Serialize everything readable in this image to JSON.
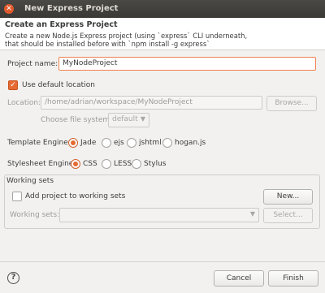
{
  "window": {
    "title": "New Express Project",
    "close_glyph": "✕"
  },
  "header": {
    "title": "Create an Express Project",
    "description_line1": "Create a new Node.js Express project (using `express` CLI underneath,",
    "description_line2": "that should be installed before with `npm install -g express`"
  },
  "project": {
    "name_label": "Project name:",
    "name_value": "MyNodeProject"
  },
  "location": {
    "use_default_label": "Use default location",
    "use_default_checked": true,
    "location_label": "Location:",
    "location_value": "/home/adrian/workspace/MyNodeProject",
    "browse_label": "Browse...",
    "fs_label": "Choose file system:",
    "fs_value": "default"
  },
  "template_engine": {
    "label": "Template Engine:",
    "options": [
      "Jade",
      "ejs",
      "jshtml",
      "hogan.js"
    ],
    "selected": "Jade"
  },
  "stylesheet_engine": {
    "label": "Stylesheet Engine:",
    "options": [
      "CSS",
      "LESS",
      "Stylus"
    ],
    "selected": "CSS"
  },
  "working_sets": {
    "group_title": "Working sets",
    "add_label": "Add project to working sets",
    "add_checked": false,
    "new_label": "New...",
    "sets_label": "Working sets:",
    "sets_value": "",
    "select_label": "Select..."
  },
  "footer": {
    "help_glyph": "?",
    "cancel_label": "Cancel",
    "finish_label": "Finish"
  },
  "colors": {
    "accent": "#e56b34",
    "titlebar": "#3c3b37"
  }
}
